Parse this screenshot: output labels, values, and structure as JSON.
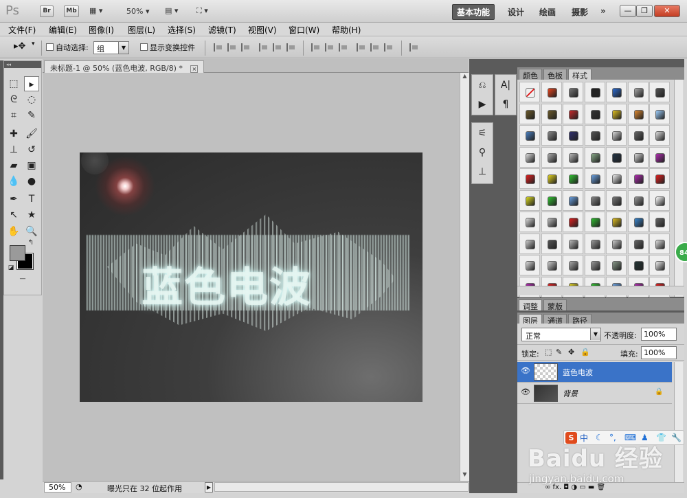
{
  "app": {
    "logo": "Ps",
    "bridge": "Br",
    "minibridge": "Mb",
    "zoom": "50%",
    "workspaces": [
      "基本功能",
      "设计",
      "绘画",
      "摄影"
    ],
    "more": "»",
    "win_min": "—",
    "win_restore": "❐",
    "win_close": "✕"
  },
  "menu": [
    "文件(F)",
    "编辑(E)",
    "图像(I)",
    "图层(L)",
    "选择(S)",
    "滤镜(T)",
    "视图(V)",
    "窗口(W)",
    "帮助(H)"
  ],
  "options": {
    "move_tool": "▸✥",
    "auto_select_label": "自动选择:",
    "auto_select_value": "组",
    "show_transform_label": "显示变换控件"
  },
  "document": {
    "tab_title": "未标题-1 @ 50% (蓝色电波, RGB/8) *",
    "close": "×",
    "artwork_text": "蓝色电波"
  },
  "status": {
    "zoom": "50%",
    "info": "曝光只在 32 位起作用",
    "arrow": "▶"
  },
  "tools": {
    "header": "◂◂",
    "foreground_color": "#9a9a9a",
    "background_color": "#000000"
  },
  "panels": {
    "top_tabs": [
      "颜色",
      "色板",
      "样式"
    ],
    "active_top_tab": "样式",
    "adjust_tabs": [
      "调整",
      "蒙版"
    ],
    "layer_tabs": [
      "图层",
      "通道",
      "路径"
    ],
    "blend_mode": "正常",
    "opacity_label": "不透明度:",
    "opacity_value": "100%",
    "lock_label": "锁定:",
    "fill_label": "填充:",
    "fill_value": "100%",
    "layers": [
      {
        "name": "蓝色电波",
        "selected": true
      },
      {
        "name": "背景",
        "selected": false
      }
    ],
    "footer_icons": "∞ fx. ◘ ◑ ▭ ▬ 🗑"
  },
  "ime": {
    "logo": "S",
    "text": "中",
    "icons": [
      "☾",
      "°,",
      "⌨",
      "♟",
      "👕",
      "🔧"
    ]
  },
  "badge": "84",
  "watermark": {
    "big": "Baidu 经验",
    "small": "jingyan.baidu.com"
  }
}
